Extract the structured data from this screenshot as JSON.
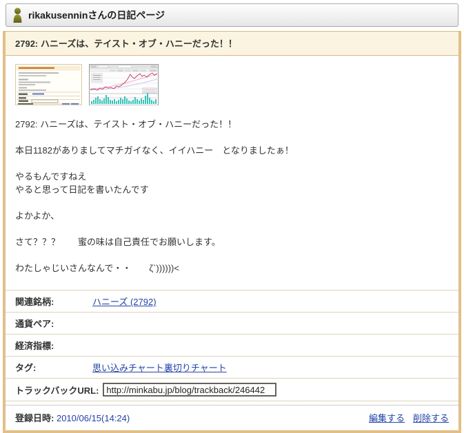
{
  "header": {
    "title": "rikakusenninさんの日記ページ",
    "user_icon": "person-icon",
    "icon_color": "#82822a"
  },
  "entry": {
    "title": "2792: ハニーズは、テイスト・オブ・ハニーだった！！",
    "thumbnails": [
      {
        "name": "diary-page-preview-thumbnail"
      },
      {
        "name": "stock-chart-preview-thumbnail"
      }
    ],
    "paragraphs": {
      "p1": "2792: ハニーズは、テイスト・オブ・ハニーだった！！",
      "p2": "本日1182がありましてマチガイなく、イイハニー　となりましたぁ！",
      "p3a": "やるもんですねえ",
      "p3b": "やると思って日記を書いたんです",
      "p4": "よかよか、",
      "p5": "さて？？？　　蜜の味は自己責任でお願いします。",
      "p6": "わたしゃじいさんなんで・・　　ζ`))))))<"
    }
  },
  "meta": {
    "rows": [
      {
        "label": "関連銘柄:",
        "value": "ハニーズ (2792)",
        "type": "link"
      },
      {
        "label": "通貨ペア:",
        "value": "",
        "type": "empty"
      },
      {
        "label": "経済指標:",
        "value": "",
        "type": "empty"
      },
      {
        "label": "タグ:",
        "value": "思い込みチャート裏切りチャート",
        "type": "link"
      },
      {
        "label": "トラックバックURL:",
        "value": "http://minkabu.jp/blog/trackback/246442",
        "type": "input"
      }
    ]
  },
  "footer": {
    "date_label": "登録日時:",
    "date_value": "2010/06/15(14:24)",
    "edit_link": "編集する",
    "delete_link": "削除する"
  },
  "colors": {
    "accent_border": "#e2bf88",
    "title_bar_bg": "#fbf4e1",
    "link": "#2143a7",
    "chart_volume": "#35c4bc",
    "chart_price": "#c2365a"
  }
}
